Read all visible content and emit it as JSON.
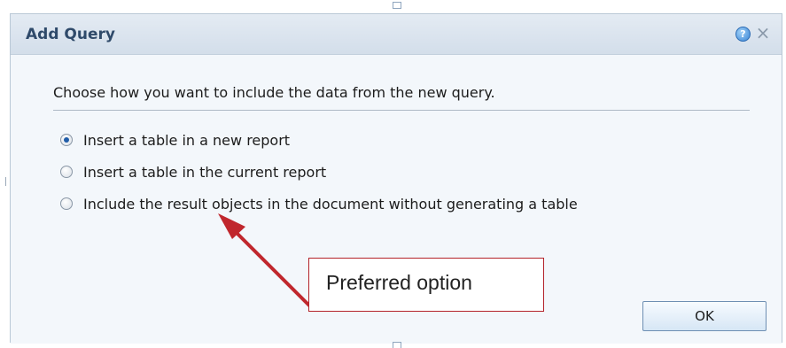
{
  "dialog": {
    "title": "Add Query",
    "instruction": "Choose how you want to include the data from the new query.",
    "options": [
      {
        "label": "Insert a table in a new report",
        "selected": true
      },
      {
        "label": "Insert a table in the current report",
        "selected": false
      },
      {
        "label": "Include the result objects in the document without generating a table",
        "selected": false
      }
    ],
    "help_icon": "?",
    "close_icon": "×",
    "ok_label": "OK"
  },
  "annotation": {
    "text": "Preferred option",
    "color": "#c0272d"
  }
}
